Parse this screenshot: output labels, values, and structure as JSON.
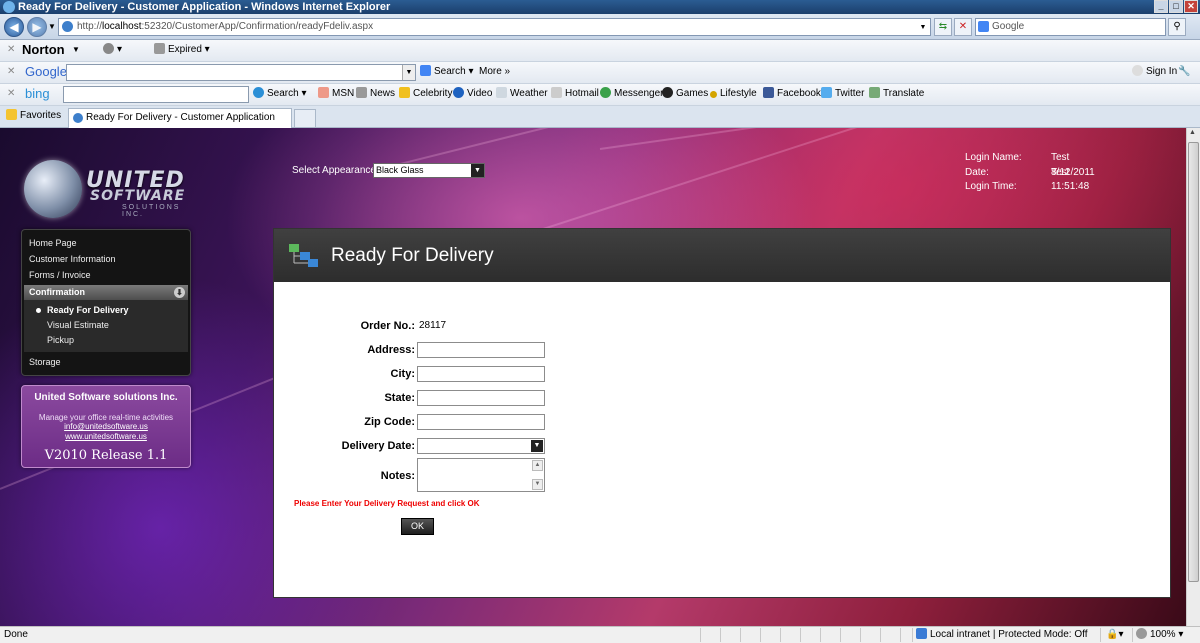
{
  "window": {
    "title": "Ready For Delivery - Customer Application - Windows Internet Explorer"
  },
  "address": {
    "url_prefix": "http://",
    "host": "localhost",
    "url_rest": ":52320/CustomerApp/Confirmation/readyFdeliv.aspx",
    "search_placeholder": "Google"
  },
  "norton": {
    "brand": "Norton",
    "expired": "Expired"
  },
  "google_bar": {
    "brand": "Google",
    "search": "Search",
    "more": "More »",
    "sign_in": "Sign In"
  },
  "bing_bar": {
    "brand": "bing",
    "items": [
      "Search",
      "MSN",
      "News",
      "Celebrity",
      "Video",
      "Weather",
      "Hotmail",
      "Messenger",
      "Games",
      "Lifestyle",
      "Facebook",
      "Twitter",
      "Translate"
    ]
  },
  "favorites": {
    "label": "Favorites",
    "tab": "Ready For Delivery - Customer Application"
  },
  "app": {
    "logo": {
      "line1": "UNITED",
      "line2": "SOFTWARE",
      "line3": "SOLUTIONS INC."
    },
    "appearance": {
      "label": "Select Appearance:",
      "value": "Black Glass"
    },
    "login": {
      "name_label": "Login Name:",
      "name": "Test Test",
      "date_label": "Date:",
      "date": "8/12/2011",
      "time_label": "Login Time:",
      "time": "11:51:48"
    },
    "nav": {
      "items": [
        "Home Page",
        "Customer Information",
        "Forms / Invoice"
      ],
      "section": "Confirmation",
      "sub": [
        "Ready For Delivery",
        "Visual Estimate",
        "Pickup"
      ],
      "after": "Storage"
    },
    "info": {
      "company": "United Software solutions Inc.",
      "desc": "Manage your office real-time activities",
      "email": "info@unitedsoftware.us",
      "web": "www.unitedsoftware.us",
      "release": "V2010 Release 1.1"
    },
    "panel": {
      "title": "Ready For Delivery"
    },
    "form": {
      "order_label": "Order No.:",
      "order_value": "28117",
      "address_label": "Address:",
      "city_label": "City:",
      "state_label": "State:",
      "zip_label": "Zip Code:",
      "delivery_label": "Delivery Date:",
      "notes_label": "Notes:",
      "message": "Please Enter Your Delivery Request and click OK",
      "ok": "OK"
    }
  },
  "status": {
    "left": "Done",
    "zone": "Local intranet | Protected Mode: Off",
    "zoom": "100%"
  }
}
